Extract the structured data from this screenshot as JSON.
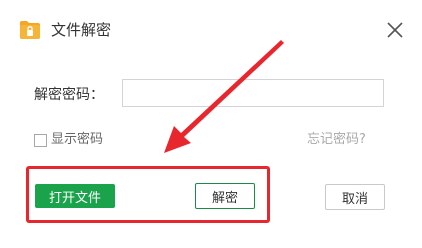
{
  "window": {
    "title": "文件解密",
    "icon": "folder-lock-icon",
    "close_icon": "close-icon"
  },
  "form": {
    "password_label": "解密密码：",
    "password_value": "",
    "password_placeholder": "",
    "show_password_label": "显示密码",
    "show_password_checked": false,
    "forgot_password_link": "忘记密码?"
  },
  "buttons": {
    "open_file": "打开文件",
    "decrypt": "解密",
    "cancel": "取消"
  },
  "annotation": {
    "type": "red-arrow-and-box",
    "color": "#e8262d"
  },
  "colors": {
    "primary_green": "#1aa34a",
    "decrypt_border_green": "#1b8a45",
    "folder_orange": "#f5a623",
    "lock_white": "#ffffff"
  }
}
